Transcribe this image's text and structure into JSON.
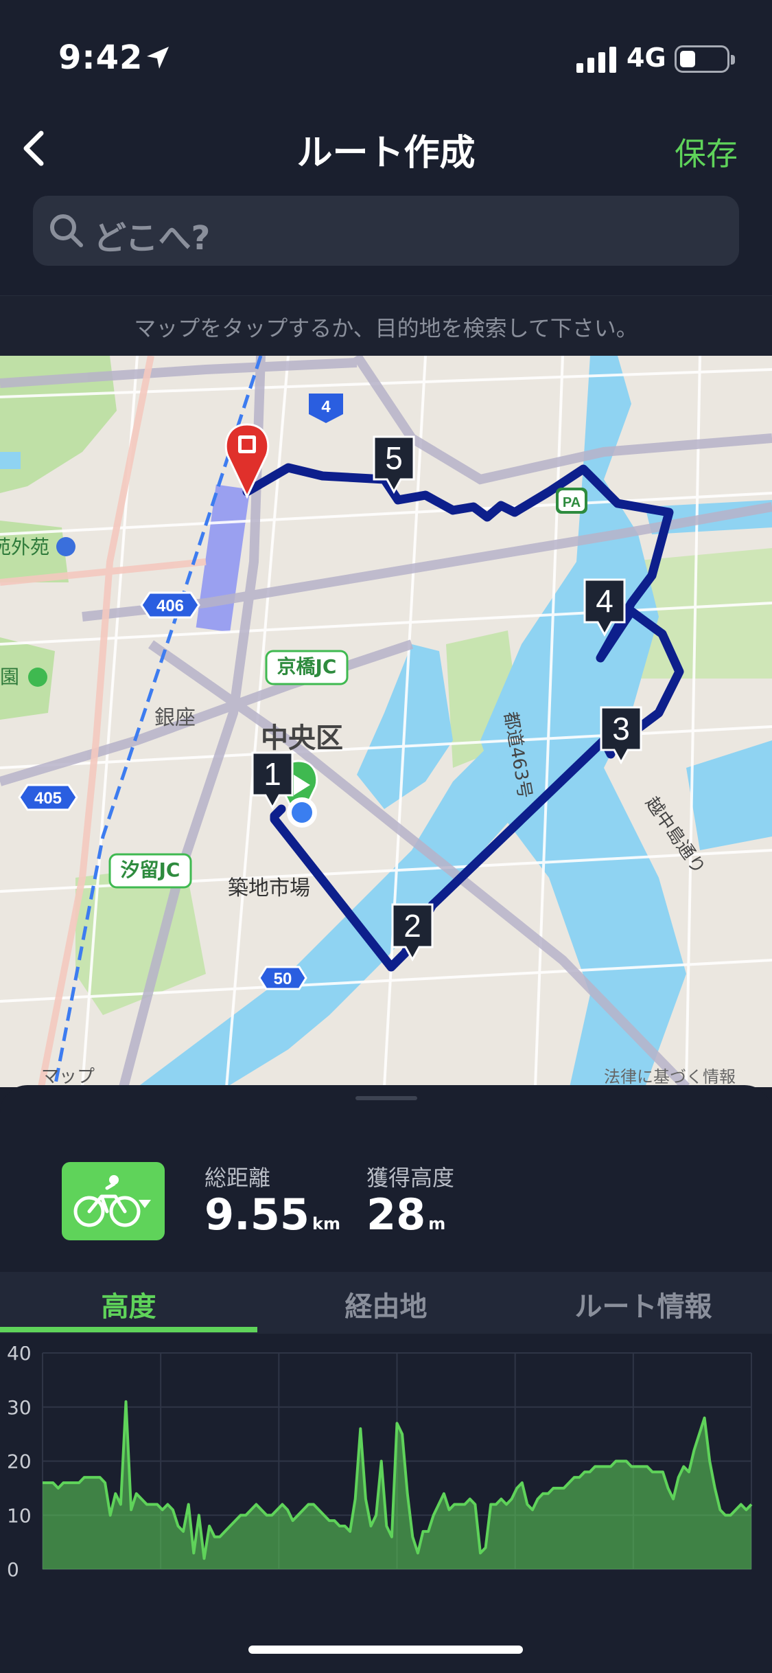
{
  "status_bar": {
    "time": "9:42",
    "network": "4G",
    "icons": [
      "location-arrow-icon",
      "signal-bars-icon",
      "battery-icon"
    ]
  },
  "nav": {
    "title": "ルート作成",
    "save_label": "保存",
    "back_icon": "chevron-left-icon"
  },
  "search": {
    "placeholder": "どこへ?",
    "icon": "search-icon"
  },
  "hint": "マップをタップするか、目的地を検索して下さい。",
  "map": {
    "labels": {
      "route4": "4",
      "route406": "406",
      "route405": "405",
      "route50": "50",
      "kyobashi_jc": "京橋JC",
      "shiodome_jc": "汐留JC",
      "ginza": "銀座",
      "chuo_ku": "中央区",
      "tsukiji": "築地市場",
      "gaien": "苑外苑",
      "en": "園",
      "pa": "PA",
      "toritsu": "都道463号",
      "etchujima": "越中島通り",
      "maps_badge": "マップ",
      "legal": "法律に基づく情報"
    },
    "waypoints": [
      "1",
      "2",
      "3",
      "4",
      "5"
    ],
    "colors": {
      "route": "#0d1f8c",
      "start": "#3fb950",
      "end": "#e0302b",
      "water": "#8fd3f2"
    }
  },
  "summary": {
    "mode_icon": "bicycle-icon",
    "distance_label": "総距離",
    "distance_value": "9.55",
    "distance_unit": "km",
    "elevation_label": "獲得高度",
    "elevation_value": "28",
    "elevation_unit": "m"
  },
  "tabs": [
    {
      "label": "高度",
      "active": true
    },
    {
      "label": "経由地",
      "active": false
    },
    {
      "label": "ルート情報",
      "active": false
    }
  ],
  "chart_data": {
    "type": "area",
    "title": "",
    "xlabel": "",
    "ylabel": "",
    "ylim": [
      0,
      40
    ],
    "yticks": [
      "0",
      "10",
      "20",
      "30",
      "40"
    ],
    "grid": true,
    "color": "#5fd35a",
    "y": [
      16,
      16,
      16,
      15,
      16,
      16,
      16,
      16,
      17,
      17,
      17,
      17,
      16,
      10,
      14,
      12,
      31,
      11,
      14,
      13,
      12,
      12,
      12,
      11,
      12,
      11,
      8,
      7,
      12,
      3,
      10,
      2,
      8,
      6,
      6,
      7,
      8,
      9,
      10,
      10,
      11,
      12,
      11,
      10,
      10,
      11,
      12,
      11,
      9,
      10,
      11,
      12,
      12,
      11,
      10,
      9,
      9,
      8,
      8,
      7,
      13,
      26,
      13,
      8,
      10,
      20,
      8,
      6,
      27,
      25,
      14,
      6,
      3,
      7,
      7,
      10,
      12,
      14,
      11,
      12,
      12,
      12,
      13,
      12,
      3,
      4,
      12,
      12,
      13,
      12,
      13,
      15,
      16,
      12,
      11,
      13,
      14,
      14,
      15,
      15,
      15,
      16,
      17,
      17,
      18,
      18,
      19,
      19,
      19,
      19,
      20,
      20,
      20,
      19,
      19,
      19,
      19,
      18,
      18,
      18,
      15,
      13,
      17,
      19,
      18,
      22,
      25,
      28,
      20,
      15,
      11,
      10,
      10,
      11,
      12,
      11,
      12
    ]
  }
}
